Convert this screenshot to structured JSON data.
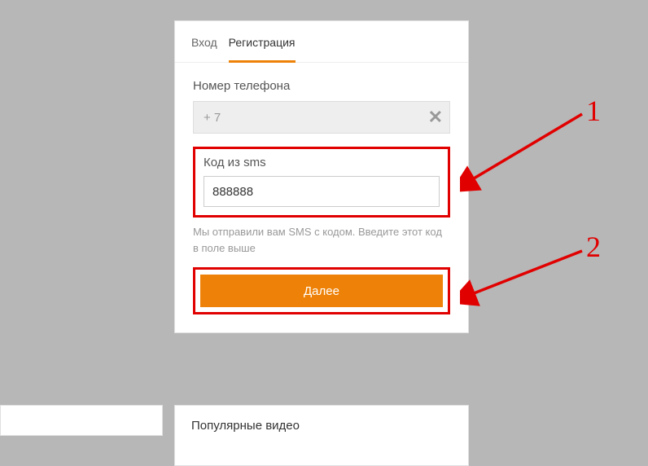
{
  "tabs": {
    "login": "Вход",
    "register": "Регистрация"
  },
  "phone": {
    "label": "Номер телефона",
    "prefix": "+ 7"
  },
  "sms": {
    "label": "Код из sms",
    "value": "888888",
    "hint": "Мы отправили вам SMS с кодом. Введите этот код в поле выше"
  },
  "button": {
    "next": "Далее"
  },
  "sections": {
    "popular": "Популярные видео"
  },
  "annotations": {
    "one": "1",
    "two": "2"
  }
}
